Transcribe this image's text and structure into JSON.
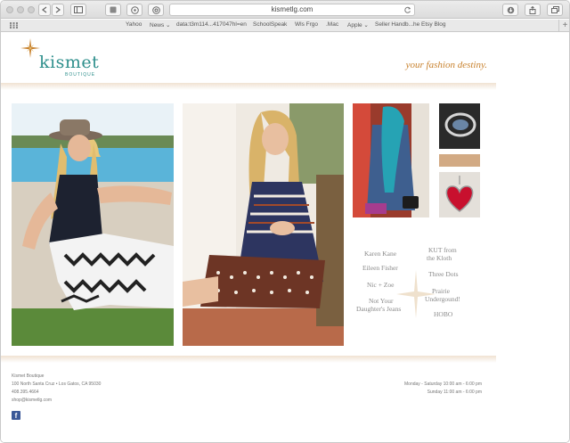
{
  "browser": {
    "url": "kismetlg.com",
    "bookmarks": [
      {
        "label": "Yahoo"
      },
      {
        "label": "News ⌄"
      },
      {
        "label": "data:t3m114...417047hl=en"
      },
      {
        "label": "SchoolSpeak"
      },
      {
        "label": "Wls Frgo"
      },
      {
        "label": ".Mac"
      },
      {
        "label": "Apple ⌄"
      },
      {
        "label": "Seller Handb...he Etsy Blog"
      }
    ]
  },
  "site": {
    "logo_text": "kismet",
    "logo_sub": "BOUTIQUE",
    "tagline": "your fashion destiny.",
    "brands": {
      "karen_kane": "Karen Kane",
      "kut_line1": "KUT from",
      "kut_line2": "the Kloth",
      "eileen": "Eileen Fisher",
      "three_dots": "Three Dots",
      "nic_zoe": "Nic + Zoe",
      "prairie_line1": "Prairie",
      "prairie_line2": "Undergound!",
      "nydj_line1": "Not Your",
      "nydj_line2": "Daughter's Jeans",
      "hobo": "HOBO"
    },
    "footer": {
      "name": "Kismet Boutique",
      "address": "100 North Santa Cruz • Los Gatos, CA 95030",
      "phone": "408.395.4664",
      "email": "shop@kismetlg.com",
      "hours_weekday": "Monday - Saturday 10:00 am - 6:00 pm",
      "hours_sunday": "Sunday 11:00 am - 6:00 pm"
    }
  },
  "colors": {
    "teal": "#2e8f8c",
    "gold": "#c8822e",
    "band": "#f0e2d2",
    "facebook": "#3b5998"
  }
}
